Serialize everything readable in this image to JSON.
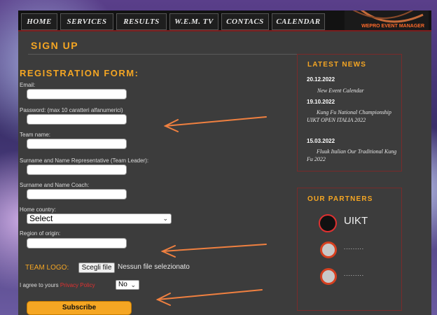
{
  "nav": {
    "tabs": [
      {
        "label": "HOME"
      },
      {
        "label": "SERVICES"
      },
      {
        "label": "RESULTS"
      },
      {
        "label": "W.E.M. TV"
      },
      {
        "label": "CONTACS"
      },
      {
        "label": "CALENDAR"
      }
    ],
    "brand_label": "WEPRO EVENT MANAGER"
  },
  "page": {
    "title": "SIGN UP",
    "form_title": "REGISTRATION FORM:"
  },
  "form": {
    "email_label": "Email:",
    "email_value": "",
    "password_label": "Password: (max 10 caratteri alfanumerici)",
    "password_value": "",
    "team_label": "Team name:",
    "team_value": "",
    "representative_label": "Surname and Name Representative (Team Leader):",
    "representative_value": "",
    "coach_label": "Surname and Name Coach:",
    "coach_value": "",
    "country_label": "Home country:",
    "country_selected": "Select",
    "region_label": "Region of origin:",
    "region_value": "",
    "logo_label": "TEAM LOGO:",
    "file_button": "Scegli file",
    "file_status": "Nessun file selezionato",
    "agree_label": "I agree to yours",
    "privacy_link": "Privacy Policy",
    "agree_selected": "No",
    "subscribe_label": "Subscribe"
  },
  "news": {
    "title": "LATEST NEWS",
    "items": [
      {
        "date": "20.12.2022",
        "text": "New Event Calendar"
      },
      {
        "date": "19.10.2022",
        "text": "Kung Fu National Championship UIKT OPEN ITALIA 2022"
      },
      {
        "date": "15.03.2022",
        "text": "Fluuk Italian Our Traditional Kung Fu 2022"
      }
    ]
  },
  "partners": {
    "title": "OUR PARTNERS",
    "items": [
      {
        "name": "UIKT"
      },
      {
        "name": "........."
      },
      {
        "name": "........."
      }
    ]
  },
  "colors": {
    "accent": "#f5a623",
    "panel": "#3c3c3c",
    "border": "#7a2a2a",
    "arrow": "#f08040",
    "link": "#e03030"
  }
}
